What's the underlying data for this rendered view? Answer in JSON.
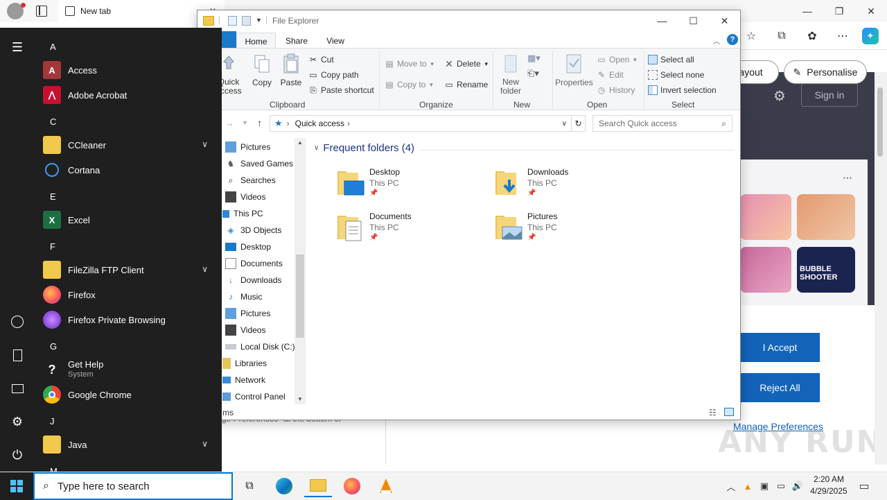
{
  "browser": {
    "tab_title": "New tab",
    "sign_in": "Sign in",
    "layout_label": "layout",
    "personalise_label": "Personalise",
    "accept_label": "I Accept",
    "reject_label": "Reject All",
    "manage_prefs": "Manage Preferences",
    "bg_text": "ge Preferences\" at the bottom of",
    "watermark": "ANY RUN",
    "game_tile_text": "BUBBLE SHOOTER"
  },
  "explorer": {
    "title": "File Explorer",
    "tabs": [
      "Home",
      "Share",
      "View"
    ],
    "ribbon": {
      "quick_access": "Quick access",
      "copy": "Copy",
      "paste": "Paste",
      "cut": "Cut",
      "copy_path": "Copy path",
      "paste_shortcut": "Paste shortcut",
      "clipboard": "Clipboard",
      "move_to": "Move to",
      "copy_to": "Copy to",
      "delete": "Delete",
      "rename": "Rename",
      "organize": "Organize",
      "new_folder": "New folder",
      "new": "New",
      "properties": "Properties",
      "open": "Open",
      "edit": "Edit",
      "history": "History",
      "open_group": "Open",
      "select_all": "Select all",
      "select_none": "Select none",
      "invert_selection": "Invert selection",
      "select_group": "Select"
    },
    "address": "Quick access",
    "search_placeholder": "Search Quick access",
    "nav_items": [
      "Pictures",
      "Saved Games",
      "Searches",
      "Videos",
      "This PC",
      "3D Objects",
      "Desktop",
      "Documents",
      "Downloads",
      "Music",
      "Pictures",
      "Videos",
      "Local Disk (C:)",
      "Libraries",
      "Network",
      "Control Panel"
    ],
    "section_title": "Frequent folders (4)",
    "folders": [
      {
        "name": "Desktop",
        "location": "This PC"
      },
      {
        "name": "Downloads",
        "location": "This PC"
      },
      {
        "name": "Documents",
        "location": "This PC"
      },
      {
        "name": "Pictures",
        "location": "This PC"
      }
    ],
    "status_text": "ms"
  },
  "start_menu": {
    "groups": [
      {
        "letter": "A",
        "apps": [
          {
            "name": "Access"
          },
          {
            "name": "Adobe Acrobat"
          }
        ]
      },
      {
        "letter": "C",
        "apps": [
          {
            "name": "CCleaner"
          },
          {
            "name": "Cortana"
          }
        ]
      },
      {
        "letter": "E",
        "apps": [
          {
            "name": "Excel"
          }
        ]
      },
      {
        "letter": "F",
        "apps": [
          {
            "name": "FileZilla FTP Client"
          },
          {
            "name": "Firefox"
          },
          {
            "name": "Firefox Private Browsing"
          }
        ]
      },
      {
        "letter": "G",
        "apps": [
          {
            "name": "Get Help",
            "sub": "System"
          },
          {
            "name": "Google Chrome"
          }
        ]
      },
      {
        "letter": "J",
        "apps": [
          {
            "name": "Java"
          }
        ]
      },
      {
        "letter": "M",
        "apps": []
      }
    ]
  },
  "taskbar": {
    "search_placeholder": "Type here to search",
    "time": "2:20 AM",
    "date": "4/29/2025"
  },
  "colors": {
    "accent": "#0078d4",
    "explorer_file_tab": "#1979ca",
    "consent_button": "#1263b9",
    "start_bg": "#1f1f1f"
  }
}
